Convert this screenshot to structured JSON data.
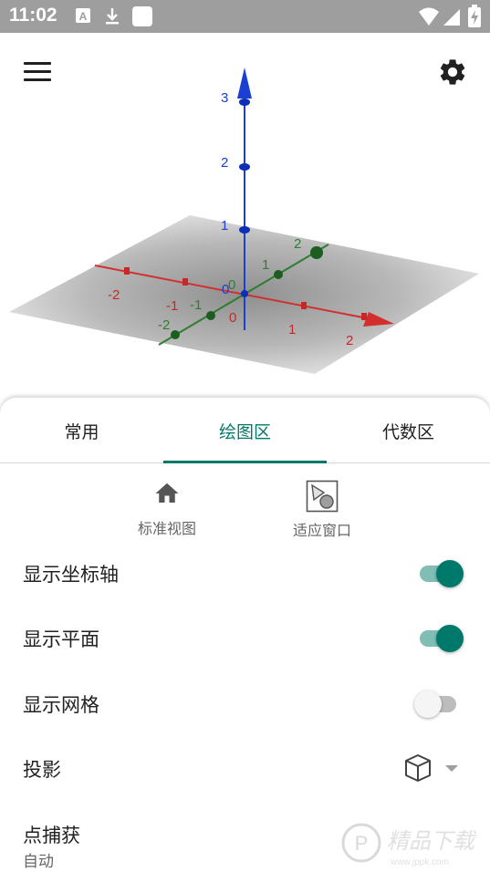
{
  "status_bar": {
    "time": "11:02",
    "icons": [
      "keyboard-a-icon",
      "download-icon",
      "blank-notification-icon",
      "wifi-icon",
      "signal-icon",
      "battery-charging-icon"
    ]
  },
  "graphics": {
    "axes_colors": {
      "x": "#d32f2f",
      "y": "#2e7d32",
      "z": "#1a3fd1"
    },
    "z_ticks": [
      "1",
      "2",
      "3"
    ],
    "x_ticks": [
      "-2",
      "-1",
      "0",
      "1",
      "2"
    ],
    "y_ticks": [
      "-2",
      "-1",
      "0",
      "1",
      "2"
    ],
    "origin_labels": [
      "0",
      "0",
      "0"
    ]
  },
  "toolbar": {
    "menu_icon": "hamburger-menu-icon",
    "settings_icon": "gear-icon"
  },
  "tabs": [
    {
      "label": "常用",
      "active": false
    },
    {
      "label": "绘图区",
      "active": true
    },
    {
      "label": "代数区",
      "active": false
    }
  ],
  "quick_actions": [
    {
      "label": "标准视图",
      "icon": "home-icon"
    },
    {
      "label": "适应窗口",
      "icon": "fit-window-icon"
    }
  ],
  "settings": [
    {
      "label": "显示坐标轴",
      "type": "switch",
      "on": true
    },
    {
      "label": "显示平面",
      "type": "switch",
      "on": true
    },
    {
      "label": "显示网格",
      "type": "switch",
      "on": false
    },
    {
      "label": "投影",
      "type": "dropdown",
      "icon": "cube-icon"
    },
    {
      "label": "点捕获",
      "type": "text",
      "value": "自动"
    }
  ],
  "colors": {
    "accent": "#00796b"
  },
  "watermark": {
    "text": "精品下载",
    "url_text": "www.jppk.com"
  }
}
